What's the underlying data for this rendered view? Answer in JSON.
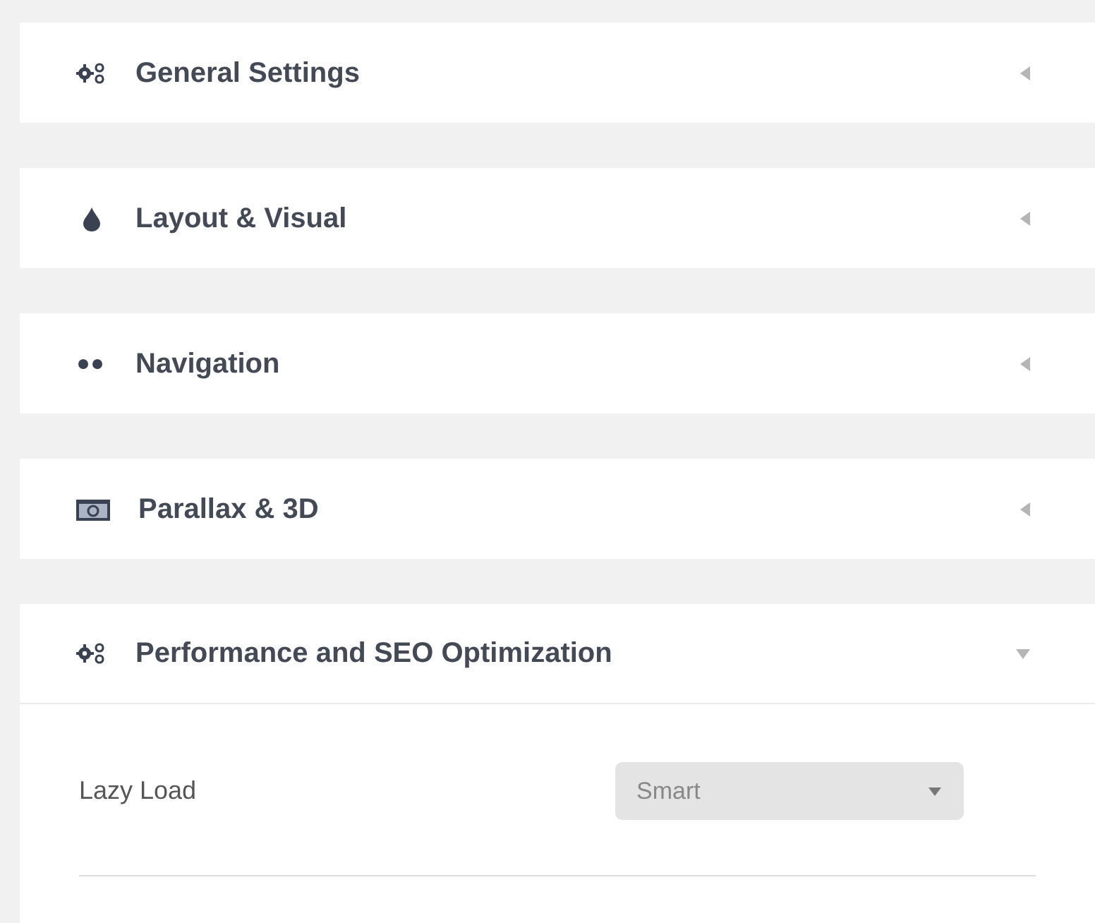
{
  "sections": [
    {
      "title": "General Settings",
      "expanded": false
    },
    {
      "title": "Layout & Visual",
      "expanded": false
    },
    {
      "title": "Navigation",
      "expanded": false
    },
    {
      "title": "Parallax & 3D",
      "expanded": false
    },
    {
      "title": "Performance and SEO Optimization",
      "expanded": true,
      "fields": [
        {
          "label": "Lazy Load",
          "value": "Smart"
        }
      ]
    }
  ]
}
